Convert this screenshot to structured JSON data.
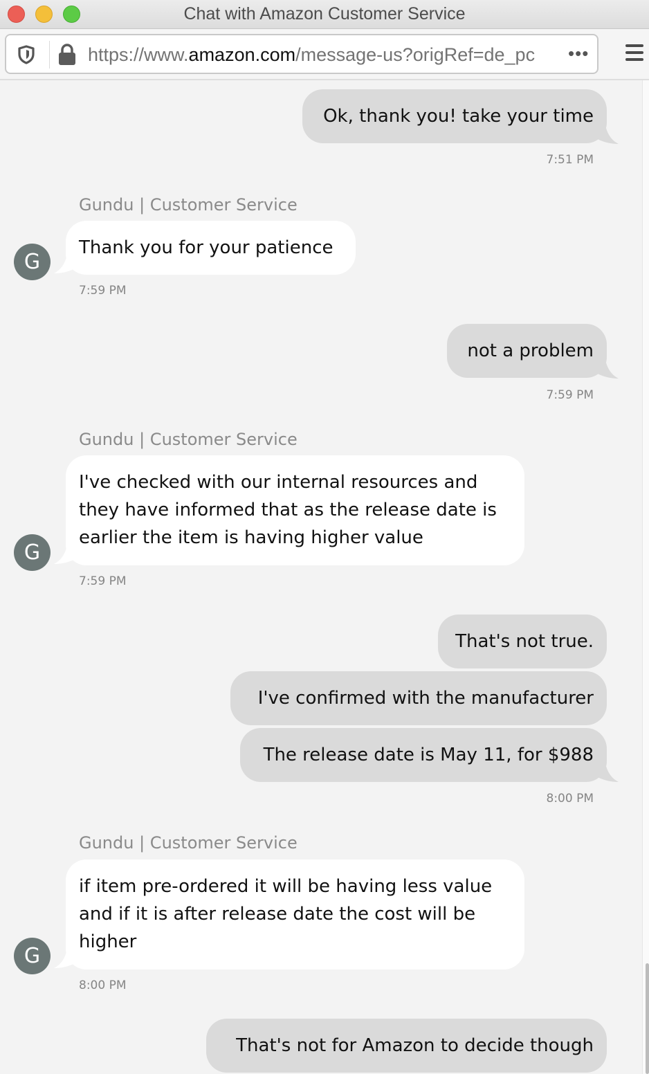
{
  "window": {
    "title": "Chat with Amazon Customer Service"
  },
  "toolbar": {
    "url_scheme": "https://www.",
    "url_host": "amazon.com",
    "url_path": "/message-us?origRef=de_pc",
    "more_label": "•••",
    "icons": {
      "shield": "tracking-protection-shield-icon",
      "lock": "lock-icon",
      "menu": "hamburger-menu-icon"
    }
  },
  "colors": {
    "outgoing_bubble": "#dadada",
    "incoming_bubble": "#ffffff",
    "background": "#f3f3f3",
    "avatar": "#6b7776",
    "timestamp": "#858585"
  },
  "messages": [
    {
      "direction": "out",
      "text": "Ok, thank you! take your time",
      "time": "7:51 PM"
    },
    {
      "direction": "in",
      "sender": "Gundu | Customer Service",
      "avatar": "G",
      "lines": [
        "Thank you for your patience"
      ],
      "time": "7:59 PM"
    },
    {
      "direction": "out",
      "text": "not a problem",
      "time": "7:59 PM"
    },
    {
      "direction": "in",
      "sender": "Gundu | Customer Service",
      "avatar": "G",
      "lines": [
        "I've checked with our internal resources and",
        "they have informed that as the release date is",
        "earlier the item is having higher value"
      ],
      "time": "7:59 PM"
    },
    {
      "direction": "out",
      "group": [
        "That's not true.",
        "I've confirmed with the manufacturer",
        "The release date is May 11, for $988"
      ],
      "time": "8:00 PM"
    },
    {
      "direction": "in",
      "sender": "Gundu | Customer Service",
      "avatar": "G",
      "lines": [
        "if item pre-ordered it will be having less value",
        "and if it is after release date the cost will be",
        "higher"
      ],
      "time": "8:00 PM"
    },
    {
      "direction": "out",
      "text": "That's not for Amazon to decide though"
    }
  ]
}
